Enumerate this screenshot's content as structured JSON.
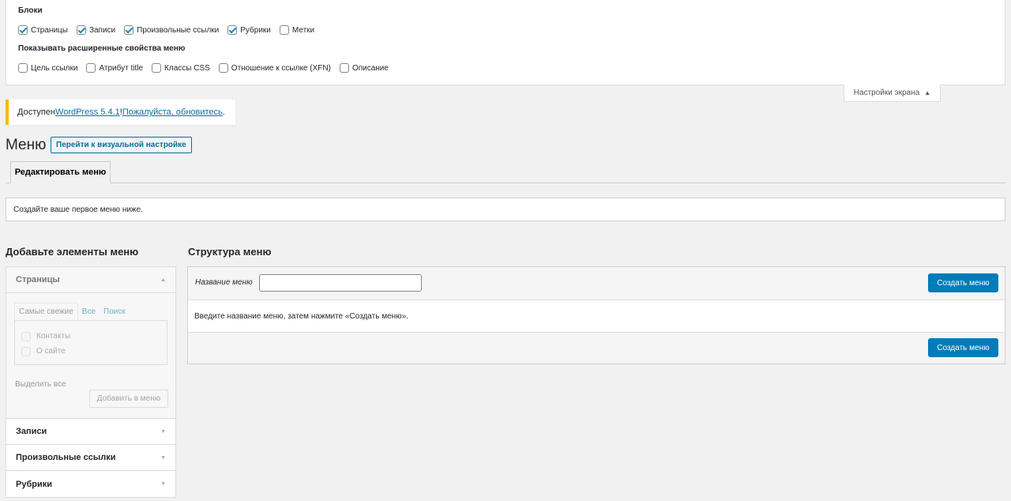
{
  "screen_options": {
    "blocks_heading": "Блоки",
    "blocks": [
      {
        "label": "Страницы",
        "checked": true
      },
      {
        "label": "Записи",
        "checked": true
      },
      {
        "label": "Произвольные ссылки",
        "checked": true
      },
      {
        "label": "Рубрики",
        "checked": true
      },
      {
        "label": "Метки",
        "checked": false
      }
    ],
    "advanced_heading": "Показывать расширенные свойства меню",
    "advanced": [
      {
        "label": "Цель ссылки",
        "checked": false
      },
      {
        "label": "Атрибут title",
        "checked": false
      },
      {
        "label": "Классы CSS",
        "checked": false
      },
      {
        "label": "Отношение к ссылке (XFN)",
        "checked": false
      },
      {
        "label": "Описание",
        "checked": false
      }
    ],
    "tab_label": "Настройки экрана",
    "tab_arrow": "▲"
  },
  "update_nag": {
    "prefix": "Доступен ",
    "link1": "WordPress 5.4.1",
    "middle": "! ",
    "link2": "Пожалуйста, обновитесь",
    "suffix": "."
  },
  "page": {
    "title": "Меню",
    "action_button": "Перейти к визуальной настройке"
  },
  "tabs": {
    "active": "Редактировать меню"
  },
  "notice": {
    "text": "Создайте ваше первое меню ниже."
  },
  "left": {
    "heading": "Добавьте элементы меню",
    "sections": [
      {
        "label": "Страницы",
        "arrow": "▲"
      },
      {
        "label": "Записи",
        "arrow": "▼"
      },
      {
        "label": "Произвольные ссылки",
        "arrow": "▼"
      },
      {
        "label": "Рубрики",
        "arrow": "▼"
      }
    ],
    "inner_tabs": [
      "Самые свежие",
      "Все",
      "Поиск"
    ],
    "items": [
      "Контакты",
      "О сайте"
    ],
    "select_all": "Выделить все",
    "add_button": "Добавить в меню"
  },
  "right": {
    "heading": "Структура меню",
    "menu_name_label": "Название меню",
    "menu_name_value": "",
    "create_button": "Создать меню",
    "instruction": "Введите название меню, затем нажмите «Создать меню»."
  }
}
